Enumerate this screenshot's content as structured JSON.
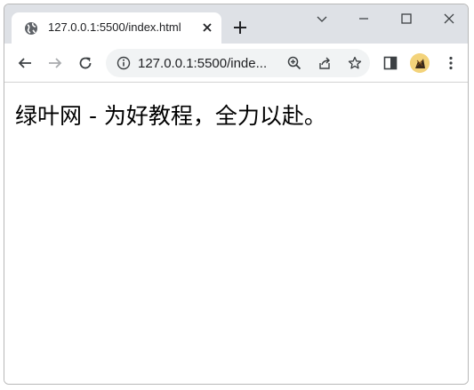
{
  "browser": {
    "tab": {
      "title": "127.0.0.1:5500/index.html",
      "favicon": "globe-icon"
    },
    "new_tab_icon": "plus-icon",
    "window_controls": [
      "chevron-down-icon",
      "minimize-icon",
      "maximize-icon",
      "close-icon"
    ],
    "toolbar": {
      "back_icon": "arrow-left-icon",
      "forward_icon": "arrow-right-icon",
      "reload_icon": "reload-icon",
      "url_text": "127.0.0.1:5500/inde...",
      "site_info_icon": "info-icon",
      "zoom_icon": "zoom-in-icon",
      "share_icon": "share-icon",
      "bookmark_icon": "star-icon",
      "side_panel_icon": "side-panel-icon",
      "profile_icon": "avatar",
      "menu_icon": "kebab-menu-icon"
    }
  },
  "page": {
    "heading": "绿叶网 - 为好教程，全力以赴。"
  }
}
